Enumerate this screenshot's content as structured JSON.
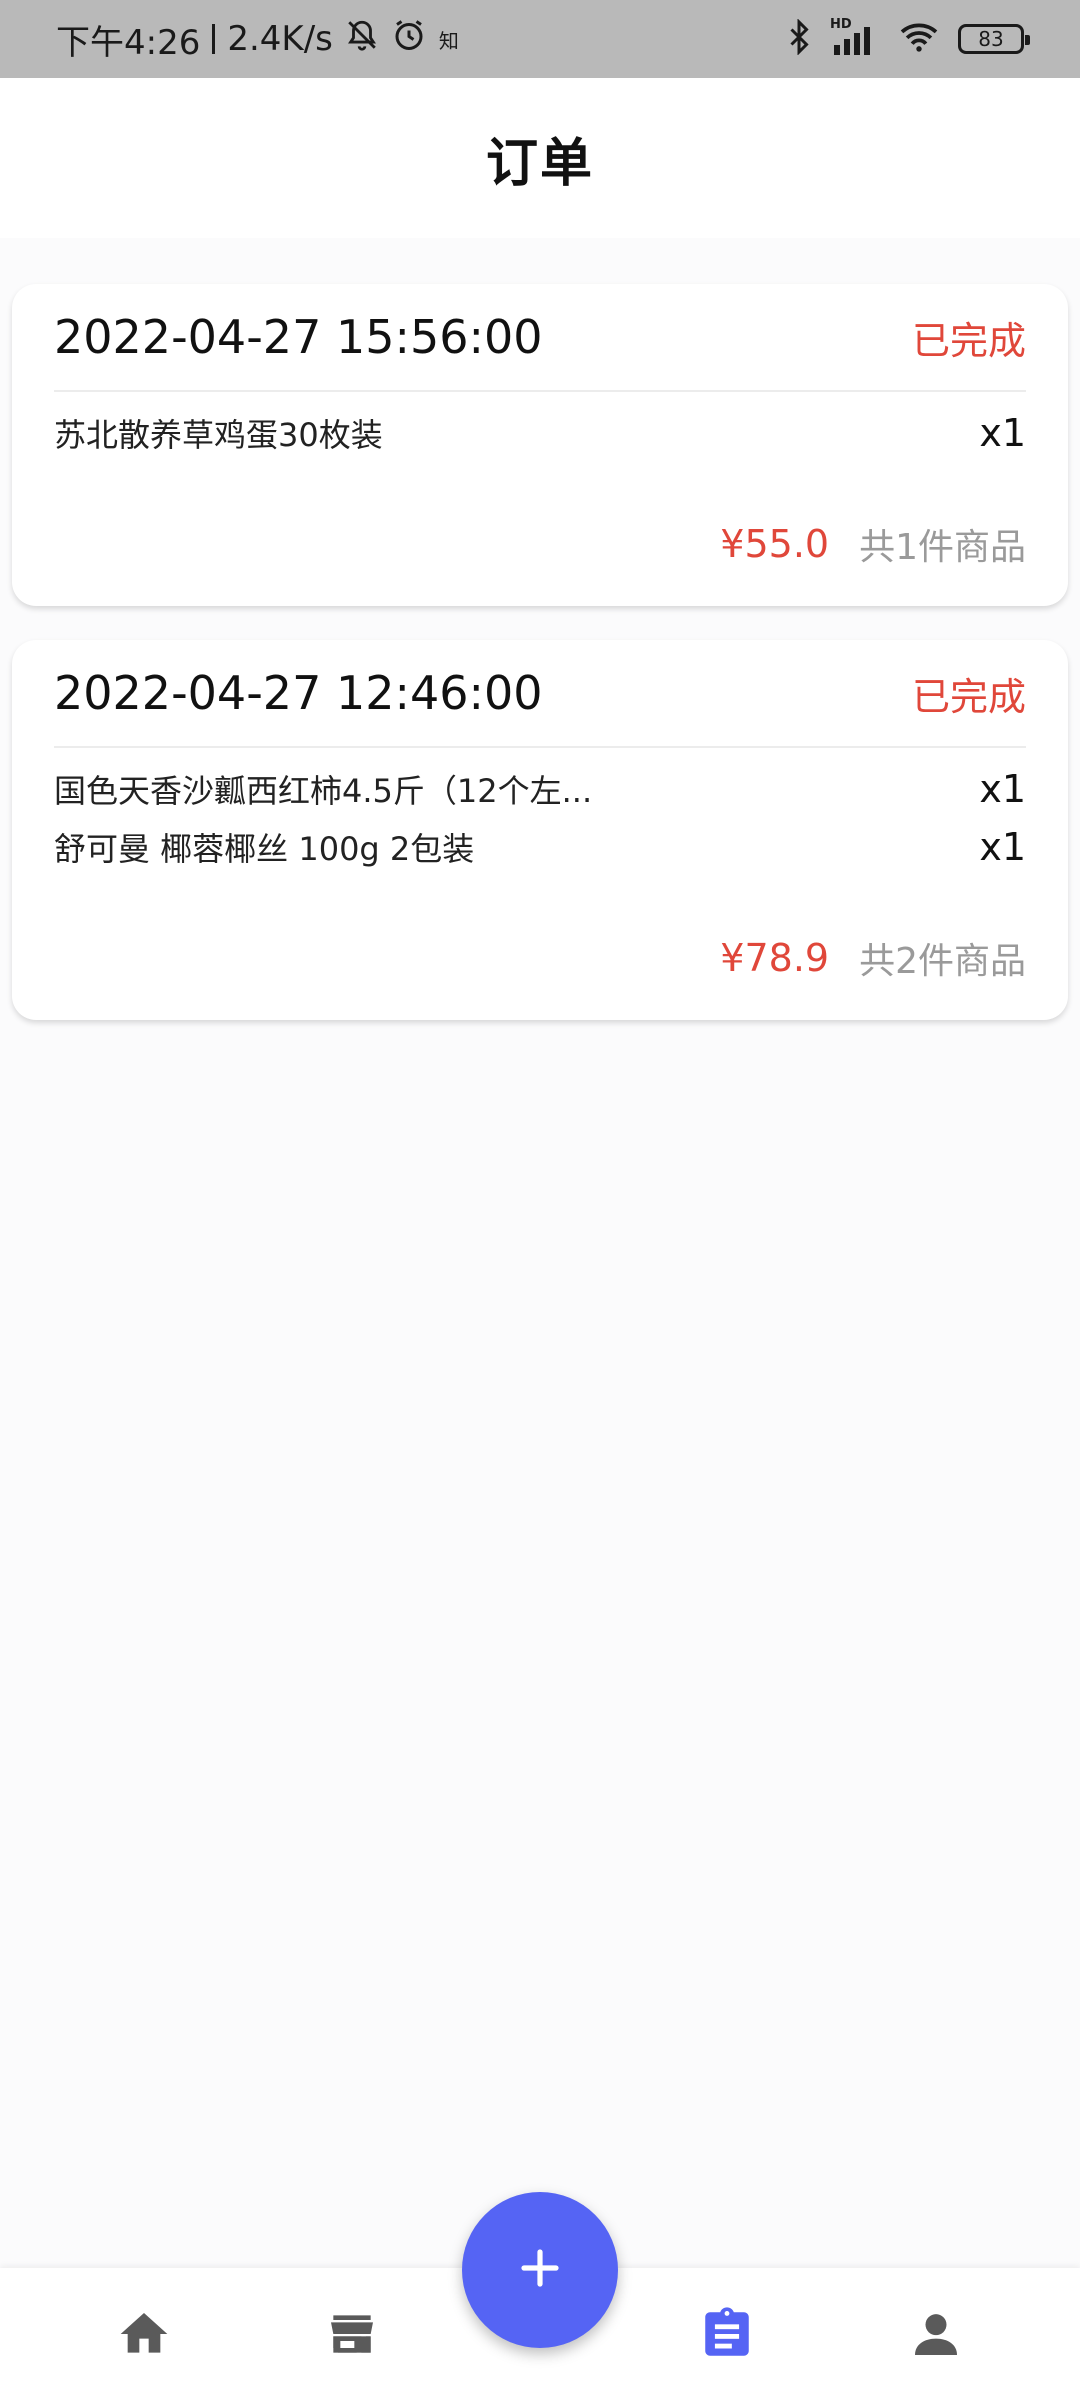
{
  "status_bar": {
    "time": "下午4:26",
    "net_speed": "2.4K/s",
    "app_badge": "知",
    "battery": "83",
    "hd_label": "HD"
  },
  "header": {
    "title": "订单"
  },
  "orders": [
    {
      "time": "2022-04-27 15:56:00",
      "status": "已完成",
      "items": [
        {
          "name": "苏北散养草鸡蛋30枚装",
          "qty": "x1"
        }
      ],
      "price": "¥55.0",
      "count": "共1件商品"
    },
    {
      "time": "2022-04-27 12:46:00",
      "status": "已完成",
      "items": [
        {
          "name": "国色天香沙瓤西红柿4.5斤（12个左...",
          "qty": "x1"
        },
        {
          "name": "舒可曼 椰蓉椰丝 100g 2包装",
          "qty": "x1"
        }
      ],
      "price": "¥78.9",
      "count": "共2件商品"
    }
  ],
  "bottom_nav": {
    "items": [
      {
        "icon": "home-icon",
        "active": false
      },
      {
        "icon": "store-icon",
        "active": false
      },
      {
        "icon": "orders-icon",
        "active": true
      },
      {
        "icon": "person-icon",
        "active": false
      }
    ],
    "fab_icon": "plus-icon"
  },
  "colors": {
    "accent": "#5564f4",
    "status_red": "#e0473a",
    "inactive_icon": "#5a5a5a"
  }
}
